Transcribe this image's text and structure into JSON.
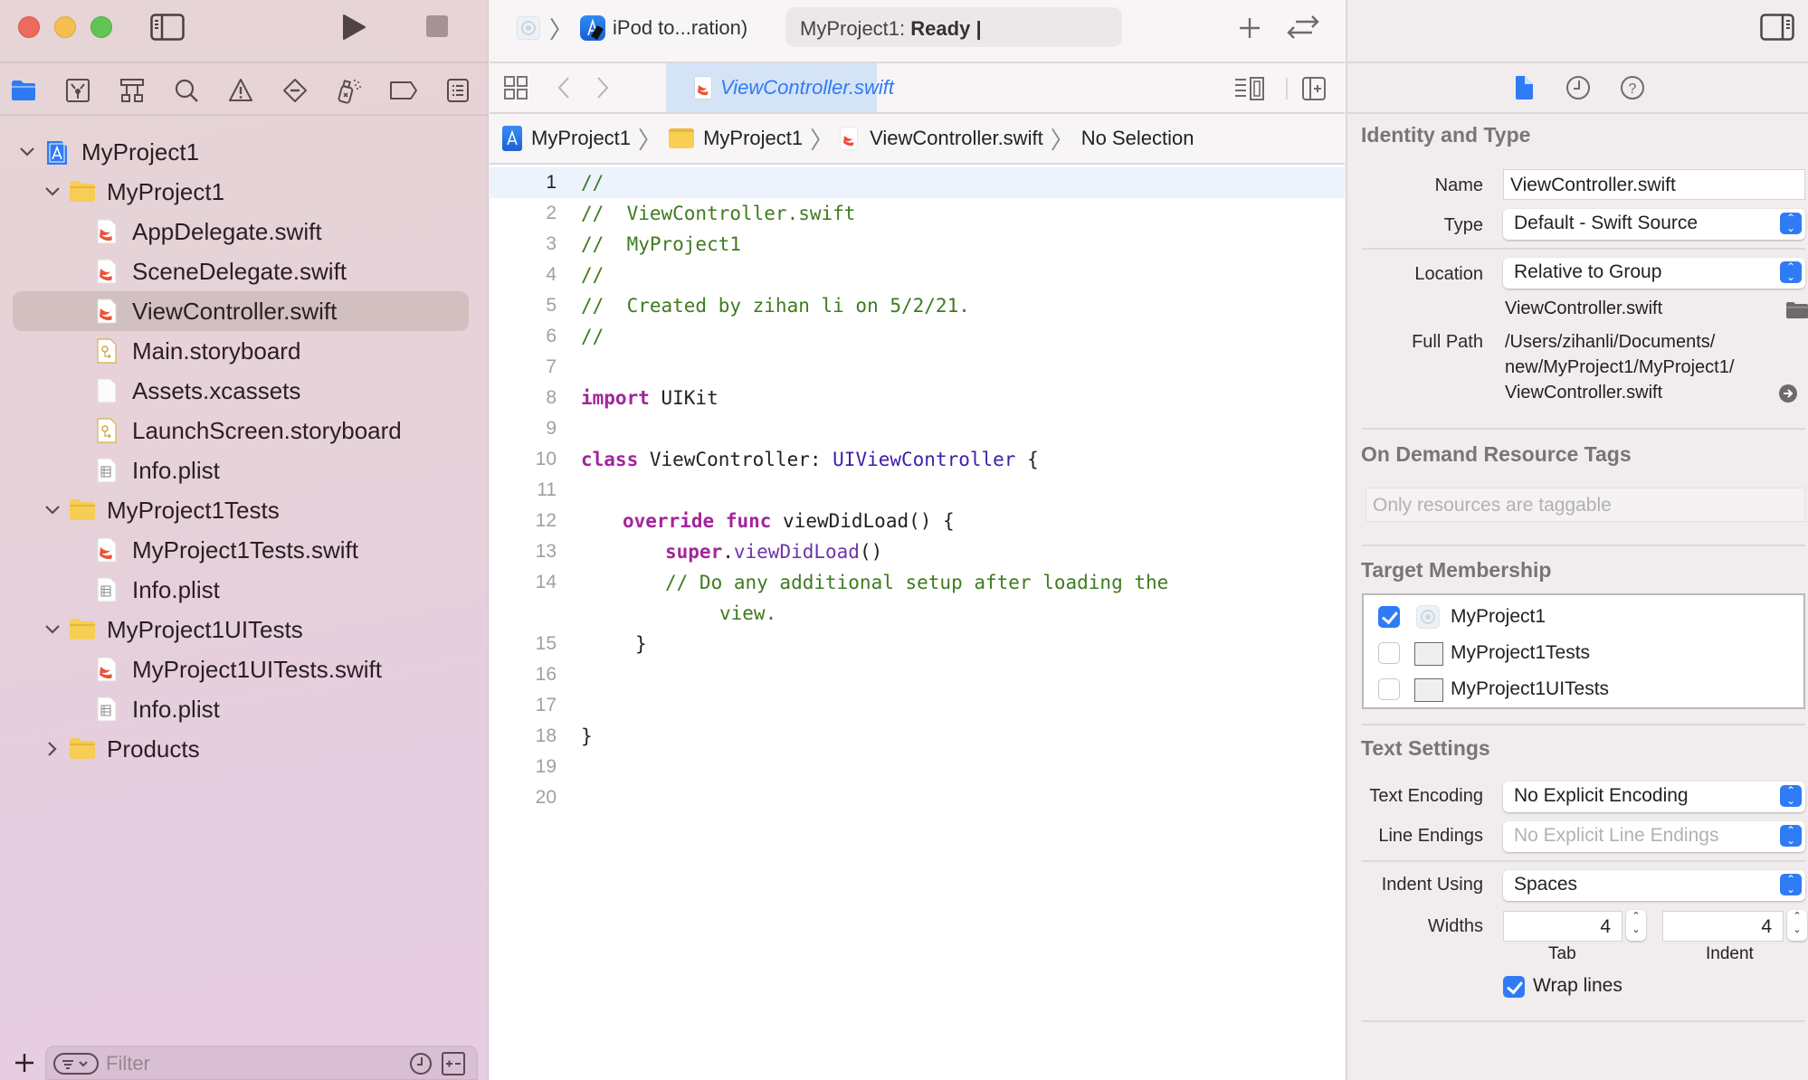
{
  "window": {
    "app": "Xcode"
  },
  "toolbar": {
    "scheme_target_label": "iPod to...ration)",
    "status_project": "MyProject1:",
    "status_state": "Ready",
    "status_cursor": "|"
  },
  "navigator": {
    "tabs": [
      {
        "name": "project-navigator",
        "active": true
      },
      {
        "name": "source-control-navigator",
        "active": false
      },
      {
        "name": "symbol-navigator",
        "active": false
      },
      {
        "name": "find-navigator",
        "active": false
      },
      {
        "name": "issue-navigator",
        "active": false
      },
      {
        "name": "test-navigator",
        "active": false
      },
      {
        "name": "debug-navigator",
        "active": false
      },
      {
        "name": "breakpoint-navigator",
        "active": false
      },
      {
        "name": "report-navigator",
        "active": false
      }
    ],
    "tree": [
      {
        "label": "MyProject1",
        "kind": "project",
        "depth": 0,
        "expanded": true
      },
      {
        "label": "MyProject1",
        "kind": "folder",
        "depth": 1,
        "expanded": true
      },
      {
        "label": "AppDelegate.swift",
        "kind": "swift",
        "depth": 2
      },
      {
        "label": "SceneDelegate.swift",
        "kind": "swift",
        "depth": 2
      },
      {
        "label": "ViewController.swift",
        "kind": "swift",
        "depth": 2,
        "selected": true
      },
      {
        "label": "Main.storyboard",
        "kind": "storyboard",
        "depth": 2
      },
      {
        "label": "Assets.xcassets",
        "kind": "assets",
        "depth": 2
      },
      {
        "label": "LaunchScreen.storyboard",
        "kind": "storyboard",
        "depth": 2
      },
      {
        "label": "Info.plist",
        "kind": "plist",
        "depth": 2
      },
      {
        "label": "MyProject1Tests",
        "kind": "folder",
        "depth": 1,
        "expanded": true
      },
      {
        "label": "MyProject1Tests.swift",
        "kind": "swift",
        "depth": 2
      },
      {
        "label": "Info.plist",
        "kind": "plist",
        "depth": 2
      },
      {
        "label": "MyProject1UITests",
        "kind": "folder",
        "depth": 1,
        "expanded": true
      },
      {
        "label": "MyProject1UITests.swift",
        "kind": "swift",
        "depth": 2
      },
      {
        "label": "Info.plist",
        "kind": "plist",
        "depth": 2
      },
      {
        "label": "Products",
        "kind": "folder",
        "depth": 1,
        "expanded": false
      }
    ],
    "filter_placeholder": "Filter"
  },
  "editor": {
    "active_tab": "ViewController.swift",
    "jumpbar": [
      "MyProject1",
      "MyProject1",
      "ViewController.swift",
      "No Selection"
    ],
    "current_line": 1,
    "lines": [
      {
        "n": "1",
        "text": "//"
      },
      {
        "n": "2",
        "text": "//  ViewController.swift"
      },
      {
        "n": "3",
        "text": "//  MyProject1"
      },
      {
        "n": "4",
        "text": "//"
      },
      {
        "n": "5",
        "text": "//  Created by zihan li on 5/2/21."
      },
      {
        "n": "6",
        "text": "//"
      },
      {
        "n": "7",
        "text": ""
      },
      {
        "n": "8",
        "text": "import UIKit"
      },
      {
        "n": "9",
        "text": ""
      },
      {
        "n": "10",
        "text": "class ViewController: UIViewController {"
      },
      {
        "n": "11",
        "text": ""
      },
      {
        "n": "12",
        "text": "    override func viewDidLoad() {"
      },
      {
        "n": "13",
        "text": "        super.viewDidLoad()"
      },
      {
        "n": "14",
        "text": "        // Do any additional setup after loading the view."
      },
      {
        "n": "15",
        "text": "    }"
      },
      {
        "n": "16",
        "text": ""
      },
      {
        "n": "17",
        "text": ""
      },
      {
        "n": "18",
        "text": "}"
      },
      {
        "n": "19",
        "text": ""
      },
      {
        "n": "20",
        "text": ""
      }
    ],
    "tokens": {
      "l1": "//",
      "l2": "//  ViewController.swift",
      "l3": "//  MyProject1",
      "l4": "//",
      "l5": "//  Created by zihan li on 5/2/21.",
      "l6": "//",
      "l8_kw": "import",
      "l8_rest": " UIKit",
      "l10_kw": "class",
      "l10_name": " ViewController: ",
      "l10_type": "UIViewController",
      "l10_rest": " {",
      "l12_kw1": "override",
      "l12_kw2": "func",
      "l12_rest": " viewDidLoad() {",
      "l13_kw": "super",
      "l13_dot": ".",
      "l13_fn": "viewDidLoad",
      "l13_rest": "()",
      "l14_a": "// Do any additional setup after loading the",
      "l14_b": "view.",
      "l15": "}",
      "l18": "}"
    }
  },
  "inspector": {
    "tabs": [
      {
        "name": "file-inspector",
        "active": true
      },
      {
        "name": "history-inspector",
        "active": false
      },
      {
        "name": "quick-help-inspector",
        "active": false
      }
    ],
    "identity": {
      "title": "Identity and Type",
      "name_label": "Name",
      "name_value": "ViewController.swift",
      "type_label": "Type",
      "type_value": "Default - Swift Source",
      "location_label": "Location",
      "location_value": "Relative to Group",
      "location_file": "ViewController.swift",
      "fullpath_label": "Full Path",
      "fullpath_lines": [
        "/Users/zihanli/Documents/",
        "new/MyProject1/MyProject1/",
        "ViewController.swift"
      ]
    },
    "ondemand": {
      "title": "On Demand Resource Tags",
      "placeholder": "Only resources are taggable"
    },
    "targets": {
      "title": "Target Membership",
      "items": [
        {
          "label": "MyProject1",
          "checked": true
        },
        {
          "label": "MyProject1Tests",
          "checked": false
        },
        {
          "label": "MyProject1UITests",
          "checked": false
        }
      ]
    },
    "text_settings": {
      "title": "Text Settings",
      "encoding_label": "Text Encoding",
      "encoding_value": "No Explicit Encoding",
      "line_endings_label": "Line Endings",
      "line_endings_value": "No Explicit Line Endings",
      "indent_label": "Indent Using",
      "indent_value": "Spaces",
      "widths_label": "Widths",
      "tab_width": "4",
      "indent_width": "4",
      "tab_caption": "Tab",
      "indent_caption": "Indent",
      "wrap_label": "Wrap lines",
      "wrap_checked": true
    }
  },
  "colors": {
    "accent": "#2f7bf5",
    "comment": "#3e7b1f",
    "keyword": "#a3259a",
    "type": "#3f1fa7",
    "function": "#6c36a9"
  }
}
